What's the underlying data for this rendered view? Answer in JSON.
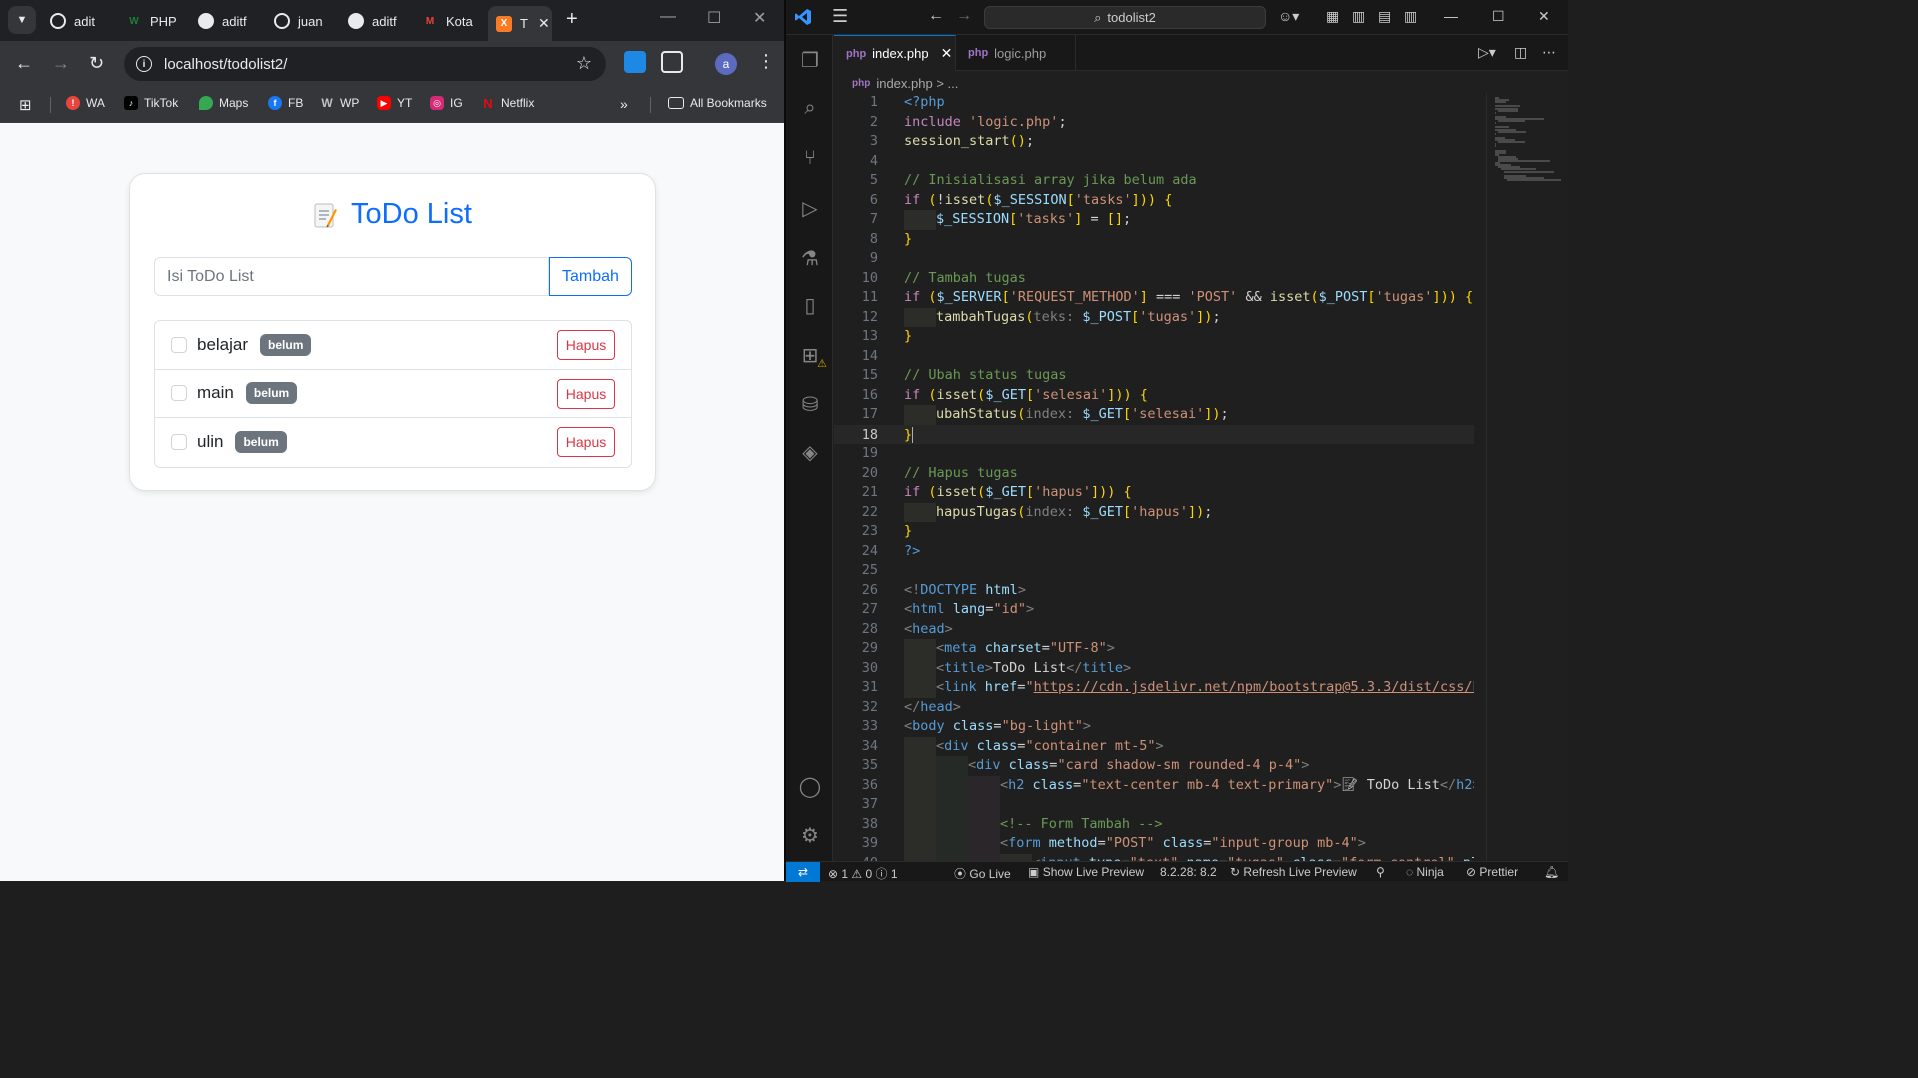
{
  "chrome": {
    "tabs": [
      {
        "label": "adit",
        "color": "#e8eaed"
      },
      {
        "label": "PHP",
        "color": "#1a7f37"
      },
      {
        "label": "aditf",
        "color": "#e8eaed"
      },
      {
        "label": "juan",
        "color": "#e8eaed"
      },
      {
        "label": "aditf",
        "color": "#e8eaed"
      },
      {
        "label": "Kota",
        "color": "#ea4335"
      },
      {
        "label": "T",
        "color": "#fb7a24"
      }
    ],
    "url": "localhost/todolist2/",
    "avatar_letter": "a",
    "bookmarks": [
      {
        "label": "WA",
        "color": "#e8453c"
      },
      {
        "label": "TikTok",
        "color": "#000000"
      },
      {
        "label": "Maps",
        "color": "#34a853"
      },
      {
        "label": "FB",
        "color": "#1877f2"
      },
      {
        "label": "WP",
        "color": "#8c8f94"
      },
      {
        "label": "YT",
        "color": "#ff0000"
      },
      {
        "label": "IG",
        "color": "#d62976"
      },
      {
        "label": "Netflix",
        "color": "#e50914"
      }
    ],
    "all_bookmarks": "All Bookmarks"
  },
  "app": {
    "title": "ToDo List",
    "input_placeholder": "Isi ToDo List",
    "add_button": "Tambah",
    "tasks": [
      {
        "name": "belajar",
        "status": "belum",
        "delete": "Hapus"
      },
      {
        "name": "main",
        "status": "belum",
        "delete": "Hapus"
      },
      {
        "name": "ulin",
        "status": "belum",
        "delete": "Hapus"
      }
    ],
    "primary_color": "#0d6efd",
    "danger_color": "#dc3545"
  },
  "vscode": {
    "command_center": "todolist2",
    "tabs": [
      {
        "label": "index.php",
        "active": true
      },
      {
        "label": "logic.php",
        "active": false
      }
    ],
    "breadcrumb": "index.php > ...",
    "current_line": 18,
    "status": {
      "problems": "1",
      "warnings": "0",
      "info": "1",
      "go_live": "Go Live",
      "show_preview": "Show Live Preview",
      "php_version": "8.2.28: 8.2",
      "refresh_preview": "Refresh Live Preview",
      "ninja": "Ninja",
      "prettier": "Prettier"
    }
  }
}
